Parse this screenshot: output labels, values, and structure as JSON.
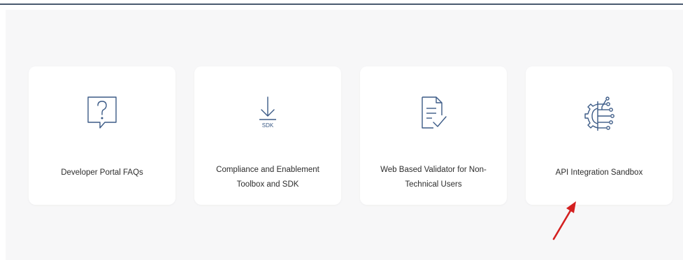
{
  "colors": {
    "icon_stroke": "#3b5a86",
    "arrow": "#d42020",
    "panel_bg": "#f7f7f8",
    "card_bg": "#ffffff",
    "text": "#2d2d2d"
  },
  "cards": [
    {
      "label": "Developer Portal FAQs",
      "icon": "question-bubble-icon"
    },
    {
      "label": "Compliance and Enablement Toolbox and SDK",
      "icon": "sdk-download-icon",
      "icon_text": "SDK"
    },
    {
      "label": "Web Based Validator for Non-Technical Users",
      "icon": "document-check-icon"
    },
    {
      "label": "API Integration Sandbox",
      "icon": "gear-circuit-icon"
    }
  ]
}
